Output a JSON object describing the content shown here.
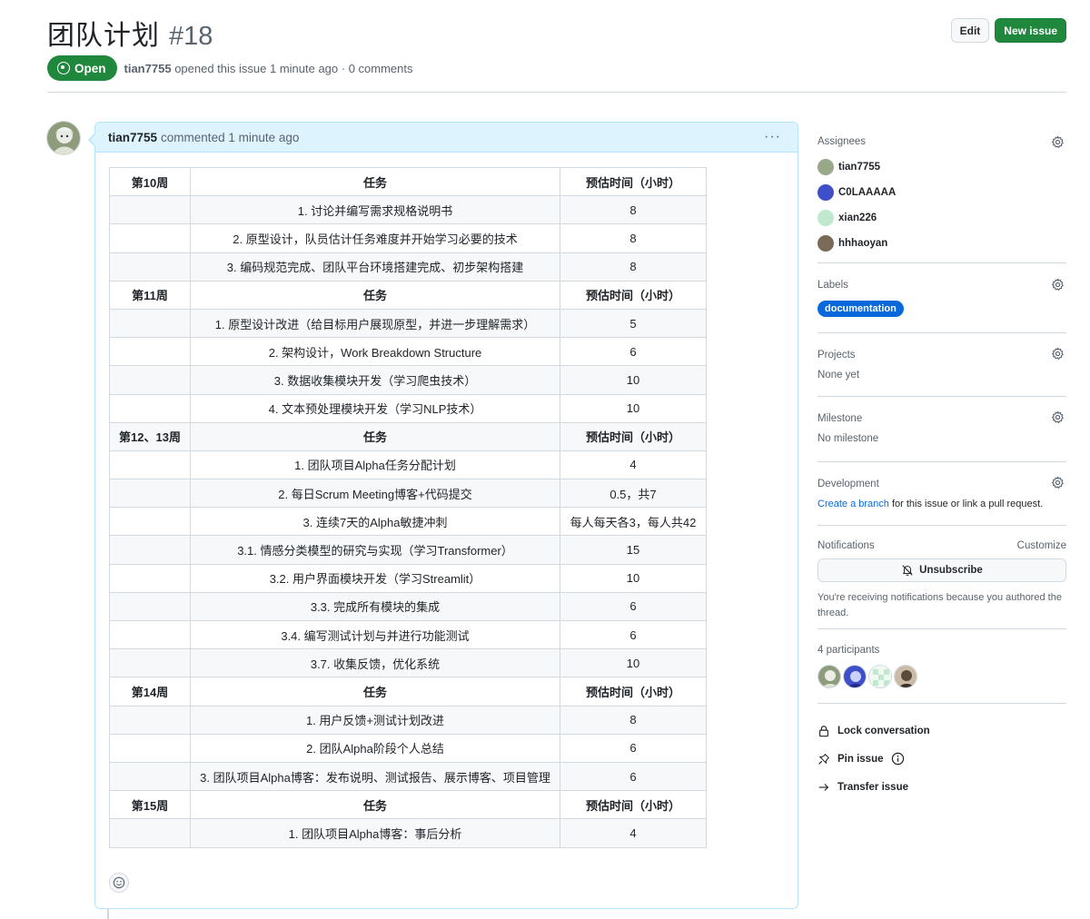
{
  "issue": {
    "title": "团队计划",
    "number": "#18",
    "state": "Open",
    "author": "tian7755",
    "meta_suffix": "opened this issue 1 minute ago · 0 comments"
  },
  "header_actions": {
    "edit_label": "Edit",
    "new_issue_label": "New issue"
  },
  "comment": {
    "author": "tian7755",
    "meta": "commented 1 minute ago",
    "menu_glyph": "···"
  },
  "table": {
    "rows": [
      {
        "type": "hdr",
        "cells": [
          "第10周",
          "任务",
          "预估时间（小时）"
        ]
      },
      {
        "type": "row",
        "cells": [
          "",
          "1. 讨论并编写需求规格说明书",
          "8"
        ]
      },
      {
        "type": "row",
        "cells": [
          "",
          "2. 原型设计，队员估计任务难度并开始学习必要的技术",
          "8"
        ]
      },
      {
        "type": "row",
        "cells": [
          "",
          "3. 编码规范完成、团队平台环境搭建完成、初步架构搭建",
          "8"
        ]
      },
      {
        "type": "hdr",
        "cells": [
          "第11周",
          "任务",
          "预估时间（小时）"
        ]
      },
      {
        "type": "row",
        "cells": [
          "",
          "1. 原型设计改进（给目标用户展现原型，并进一步理解需求）",
          "5"
        ]
      },
      {
        "type": "row",
        "cells": [
          "",
          "2. 架构设计，Work Breakdown Structure",
          "6"
        ]
      },
      {
        "type": "row",
        "cells": [
          "",
          "3. 数据收集模块开发（学习爬虫技术）",
          "10"
        ]
      },
      {
        "type": "row",
        "cells": [
          "",
          "4. 文本预处理模块开发（学习NLP技术）",
          "10"
        ]
      },
      {
        "type": "hdr",
        "cells": [
          "第12、13周",
          "任务",
          "预估时间（小时）"
        ]
      },
      {
        "type": "row",
        "cells": [
          "",
          "1. 团队项目Alpha任务分配计划",
          "4"
        ]
      },
      {
        "type": "row",
        "cells": [
          "",
          "2. 每日Scrum Meeting博客+代码提交",
          "0.5，共7"
        ]
      },
      {
        "type": "row",
        "cells": [
          "",
          "3. 连续7天的Alpha敏捷冲刺",
          "每人每天各3，每人共42"
        ]
      },
      {
        "type": "row",
        "cells": [
          "",
          "3.1. 情感分类模型的研究与实现（学习Transformer）",
          "15"
        ]
      },
      {
        "type": "row",
        "cells": [
          "",
          "3.2. 用户界面模块开发（学习Streamlit）",
          "10"
        ]
      },
      {
        "type": "row",
        "cells": [
          "",
          "3.3. 完成所有模块的集成",
          "6"
        ]
      },
      {
        "type": "row",
        "cells": [
          "",
          "3.4. 编写测试计划与并进行功能测试",
          "6"
        ]
      },
      {
        "type": "row",
        "cells": [
          "",
          "3.7. 收集反馈，优化系统",
          "10"
        ]
      },
      {
        "type": "hdr",
        "cells": [
          "第14周",
          "任务",
          "预估时间（小时）"
        ]
      },
      {
        "type": "row",
        "cells": [
          "",
          "1. 用户反馈+测试计划改进",
          "8"
        ]
      },
      {
        "type": "row",
        "cells": [
          "",
          "2. 团队Alpha阶段个人总结",
          "6"
        ]
      },
      {
        "type": "row",
        "cells": [
          "",
          "3. 团队项目Alpha博客：发布说明、测试报告、展示博客、项目管理",
          "6"
        ]
      },
      {
        "type": "hdr",
        "cells": [
          "第15周",
          "任务",
          "预估时间（小时）"
        ]
      },
      {
        "type": "row",
        "cells": [
          "",
          "1. 团队项目Alpha博客：事后分析",
          "4"
        ]
      }
    ]
  },
  "sidebar": {
    "assignees": {
      "title": "Assignees",
      "people": [
        {
          "name": "tian7755",
          "color": "#9aa88a"
        },
        {
          "name": "C0LAAAAA",
          "color": "#3f4fc8"
        },
        {
          "name": "xian226",
          "color": "#bfe8cf"
        },
        {
          "name": "hhhaoyan",
          "color": "#7a6a5a"
        }
      ]
    },
    "labels": {
      "title": "Labels",
      "items": [
        "documentation"
      ],
      "color": "#0969da"
    },
    "projects": {
      "title": "Projects",
      "value": "None yet"
    },
    "milestone": {
      "title": "Milestone",
      "value": "No milestone"
    },
    "development": {
      "title": "Development",
      "link": "Create a branch",
      "suffix": " for this issue or link a pull request."
    },
    "notifications": {
      "title": "Notifications",
      "customize": "Customize",
      "button": "Unsubscribe",
      "note": "You're receiving notifications because you authored the thread."
    },
    "participants": {
      "title": "4 participants"
    },
    "actions": {
      "lock": "Lock conversation",
      "pin": "Pin issue",
      "transfer": "Transfer issue"
    }
  },
  "colors": {
    "accent": "#1f883d",
    "link": "#0969da",
    "comment_header": "#ddf4ff"
  }
}
